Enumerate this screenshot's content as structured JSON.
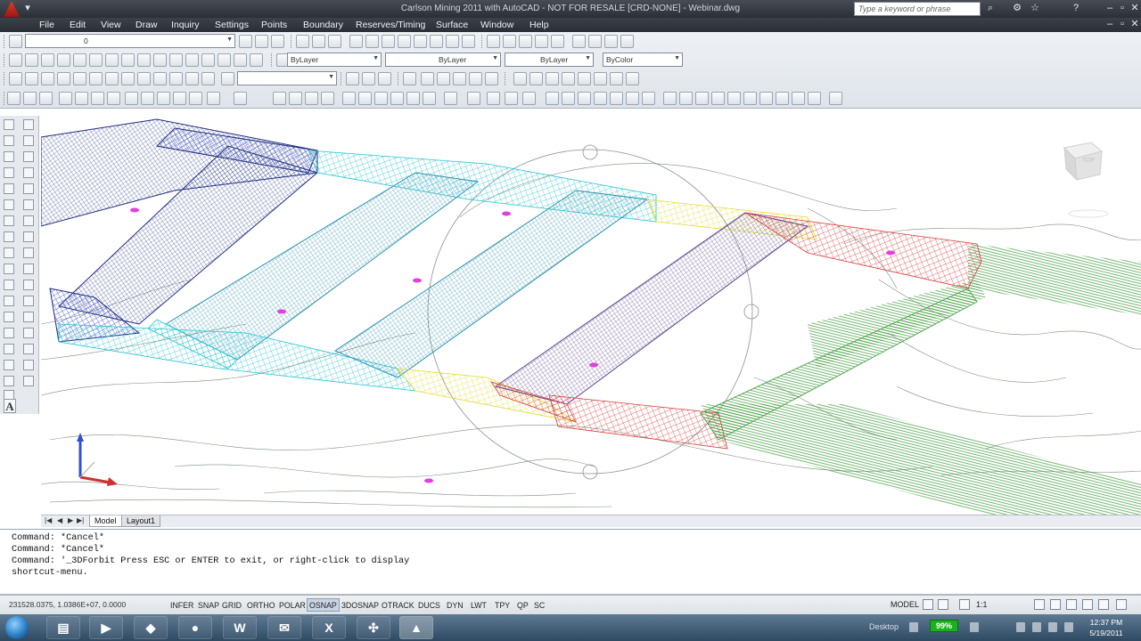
{
  "window": {
    "title": "Carlson Mining 2011 with AutoCAD - NOT FOR RESALE [CRD-NONE] - Webinar.dwg",
    "search_placeholder": "Type a keyword or phrase"
  },
  "menubar": {
    "items": [
      "File",
      "Edit",
      "View",
      "Draw",
      "Inquiry",
      "Settings",
      "Points",
      "Boundary",
      "Reserves/Timing",
      "Surface",
      "Window",
      "Help"
    ]
  },
  "toolbars": {
    "layer_combo": "0",
    "layer_combo2": "ByLayer",
    "linetype_combo": "ByLayer",
    "lineweight_combo": "ByLayer",
    "color_combo": "ByColor"
  },
  "viewcube": {
    "face_label": "TOP"
  },
  "layout_tabs": {
    "model": "Model",
    "layout1": "Layout1"
  },
  "command_history": [
    "Command: *Cancel*",
    "Command: *Cancel*",
    "Command: '_3DForbit Press ESC or ENTER to exit, or right-click to display",
    "shortcut-menu."
  ],
  "statusbar": {
    "coordinates": "231528.0375, 1.0386E+07, 0.0000",
    "toggles": [
      {
        "label": "INFER",
        "on": false
      },
      {
        "label": "SNAP",
        "on": false
      },
      {
        "label": "GRID",
        "on": false
      },
      {
        "label": "ORTHO",
        "on": false
      },
      {
        "label": "POLAR",
        "on": false
      },
      {
        "label": "OSNAP",
        "on": true
      },
      {
        "label": "3DOSNAP",
        "on": false
      },
      {
        "label": "OTRACK",
        "on": false
      },
      {
        "label": "DUCS",
        "on": false
      },
      {
        "label": "DYN",
        "on": false
      },
      {
        "label": "LWT",
        "on": false
      },
      {
        "label": "TPY",
        "on": false
      },
      {
        "label": "QP",
        "on": false
      },
      {
        "label": "SC",
        "on": false
      }
    ],
    "model_label": "MODEL",
    "annotation_scale": "1:1"
  },
  "taskbar": {
    "tray_label": "Desktop",
    "battery_percent": "99%",
    "time": "12:37 PM",
    "date": "5/19/2011"
  },
  "colors": {
    "accent_osnap": "#c9d4e3",
    "mesh_blue": "#2a3fc0",
    "mesh_cyan": "#23c4d2",
    "mesh_yellow": "#e8e23a",
    "mesh_red": "#d83a3a",
    "contour_green": "#3e9a3a",
    "point_magenta": "#e040e0"
  }
}
